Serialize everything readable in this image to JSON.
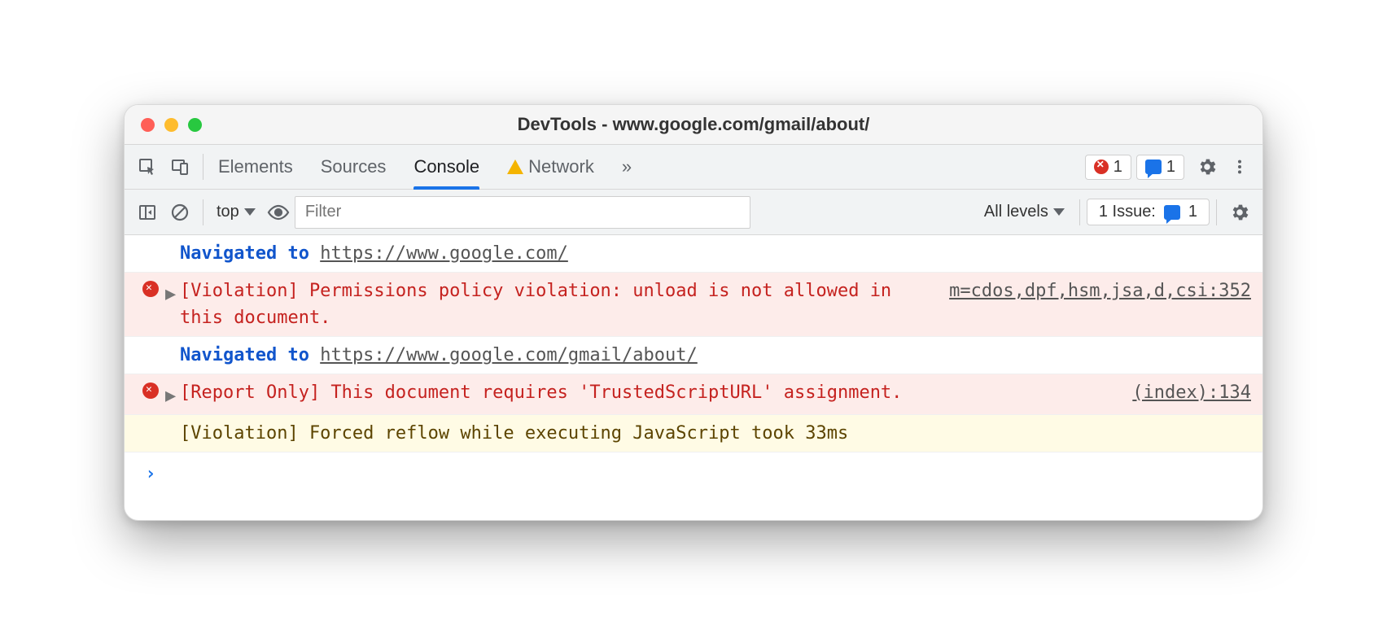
{
  "window": {
    "title": "DevTools - www.google.com/gmail/about/"
  },
  "tabs": {
    "elements": "Elements",
    "sources": "Sources",
    "console": "Console",
    "network": "Network",
    "more": "»"
  },
  "counters": {
    "errors": "1",
    "issues": "1"
  },
  "subbar": {
    "context": "top",
    "filter_placeholder": "Filter",
    "levels": "All levels",
    "issue_label": "1 Issue:",
    "issue_count": "1"
  },
  "logs": [
    {
      "type": "nav",
      "label": "Navigated to",
      "url": "https://www.google.com/"
    },
    {
      "type": "error",
      "expandable": true,
      "msg": "[Violation] Permissions policy violation: unload is not allowed in this document.",
      "src": "m=cdos,dpf,hsm,jsa,d,csi:352"
    },
    {
      "type": "nav",
      "label": "Navigated to",
      "url": "https://www.google.com/gmail/about/"
    },
    {
      "type": "error",
      "expandable": true,
      "msg": "[Report Only] This document requires 'TrustedScriptURL' assignment.",
      "src": "(index):134"
    },
    {
      "type": "warn",
      "msg": "[Violation] Forced reflow while executing JavaScript took 33ms"
    }
  ]
}
